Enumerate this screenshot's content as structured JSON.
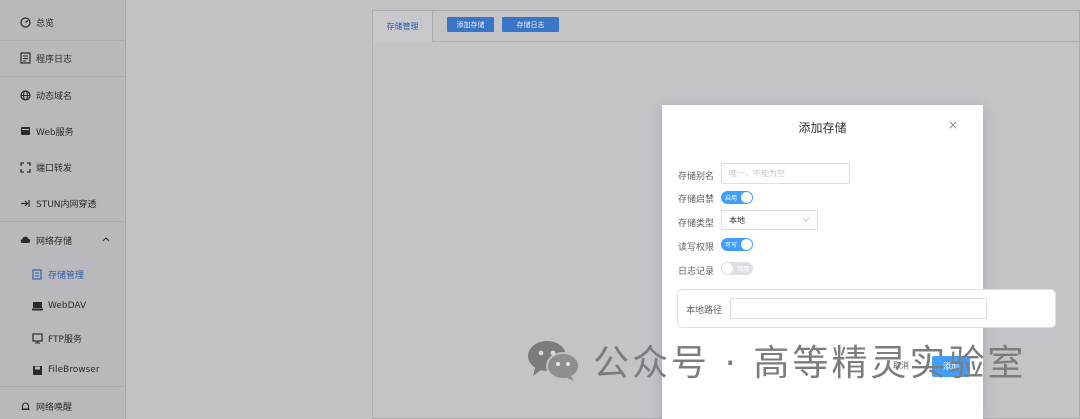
{
  "sidebar": {
    "items": [
      {
        "label": "总览",
        "icon": "dashboard-icon"
      },
      {
        "label": "程序日志",
        "icon": "log-icon"
      },
      {
        "label": "动态域名",
        "icon": "globe-icon"
      },
      {
        "label": "Web服务",
        "icon": "server-icon"
      },
      {
        "label": "端口转发",
        "icon": "port-forward-icon"
      },
      {
        "label": "STUN内网穿透",
        "icon": "stun-icon"
      },
      {
        "label": "网络存储",
        "icon": "cloud-icon"
      },
      {
        "label": "存储管理",
        "icon": "storage-icon"
      },
      {
        "label": "WebDAV",
        "icon": "drive-icon"
      },
      {
        "label": "FTP服务",
        "icon": "monitor-icon"
      },
      {
        "label": "FileBrowser",
        "icon": "save-icon"
      },
      {
        "label": "网络唤醒",
        "icon": "bell-icon"
      }
    ]
  },
  "tabs": {
    "active": "存储管理"
  },
  "toolbar": {
    "add_storage": "添加存储",
    "storage_log": "存储日志"
  },
  "dialog": {
    "title": "添加存储",
    "alias_label": "存储别名",
    "alias_placeholder": "唯一，不能为空",
    "enable_label": "存储启禁",
    "enable_value": "启用",
    "type_label": "存储类型",
    "type_value": "本地",
    "rw_label": "读写权限",
    "rw_value": "可写",
    "log_label": "日志记录",
    "log_value": "禁用",
    "path_label": "本地路径",
    "cancel": "取消",
    "confirm": "添加"
  },
  "watermark": {
    "text": "公众号 · 高等精灵实验室"
  },
  "colors": {
    "accent": "#409eff",
    "primary_dark": "#3a76c6"
  }
}
